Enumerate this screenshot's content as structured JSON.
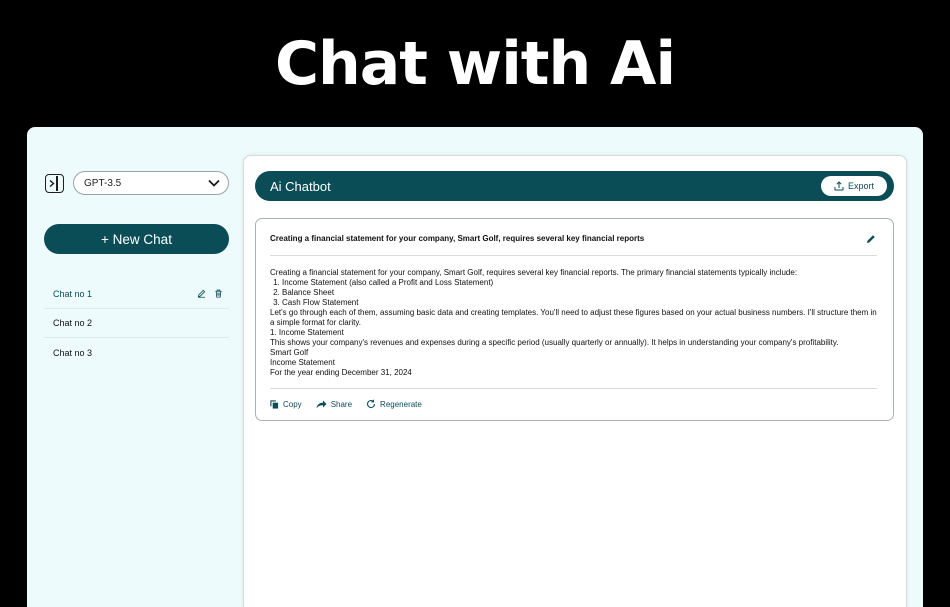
{
  "hero": {
    "title": "Chat with Ai"
  },
  "sidebar": {
    "model": "GPT-3.5",
    "new_chat_label": "+ New Chat",
    "chats": [
      {
        "label": "Chat no 1",
        "active": true
      },
      {
        "label": "Chat no 2",
        "active": false
      },
      {
        "label": "Chat no 3",
        "active": false
      }
    ]
  },
  "main": {
    "title": "Ai Chatbot",
    "export_label": "Export",
    "message": {
      "title": "Creating a financial statement for your company, Smart Golf, requires several key financial reports",
      "intro": "Creating a financial statement for your company, Smart Golf, requires several key financial reports. The primary financial statements typically include:",
      "list": [
        "Income Statement (also called a Profit and Loss Statement)",
        "Balance Sheet",
        "Cash Flow Statement"
      ],
      "lines": [
        "Let's go through each of them, assuming basic data and creating templates. You'll need to adjust these figures based on your actual business numbers. I'll structure them in a simple format for clarity.",
        "1. Income Statement",
        "This shows your company's revenues and expenses during a specific period (usually quarterly or annually). It helps in understanding your company's profitability.",
        "Smart Golf",
        "Income Statement",
        "For the year ending December 31, 2024"
      ],
      "actions": {
        "copy": "Copy",
        "share": "Share",
        "regenerate": "Regenerate"
      }
    }
  },
  "colors": {
    "accent": "#0b4d57",
    "app_bg": "#eefbfd"
  }
}
